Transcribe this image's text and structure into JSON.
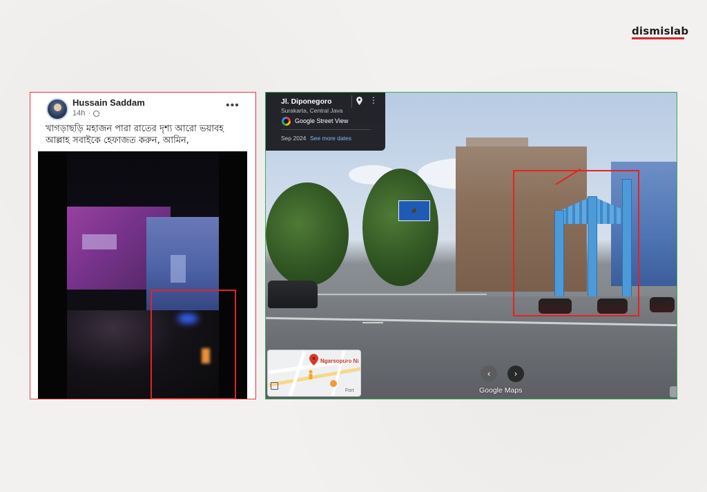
{
  "brand": {
    "logo_text": "dismislab",
    "accent": "#d8262e"
  },
  "facebook_post": {
    "author": "Hussain Saddam",
    "time": "14h",
    "privacy_icon": "globe-icon",
    "more_label": "•••",
    "text_line1": "খাগড়াছড়ি মহাজন পারা রাতের দৃশ্য আরো ভয়াবহ",
    "text_line2": "আল্লাহ সবাইকে হেফাজত করুন, আমিন,",
    "highlight_color": "#e52222"
  },
  "street_view": {
    "street": "Jl. Diponegoro",
    "location": "Surakarta, Central Java",
    "source_label": "Google Street View",
    "date": "Sep 2024",
    "more_dates_label": "See more dates",
    "minimap_place": "Ngarsopuro Ni",
    "minimap_text2": "Fort",
    "brand_google": "Google",
    "brand_maps": "Maps",
    "prev_icon": "chevron-left-icon",
    "next_icon": "chevron-right-icon",
    "prev_glyph": "‹",
    "next_glyph": "›",
    "highlight_color": "#e52222",
    "border_color": "#3aa660"
  }
}
